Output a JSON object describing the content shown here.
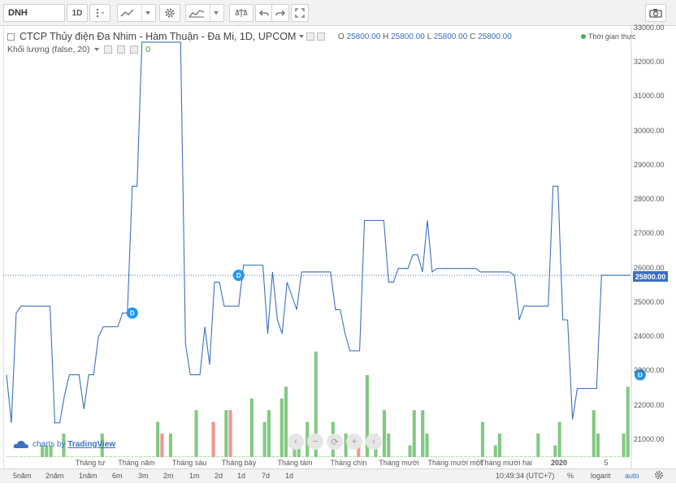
{
  "toolbar": {
    "symbol": "DNH",
    "interval": "1D",
    "camera_icon": "camera-icon"
  },
  "legend": {
    "title": "CTCP Thủy điện Đa Nhim - Hàm Thuận - Đa Mi, 1D, UPCOM",
    "o_label": "O",
    "o_value": "25800.00",
    "h_label": "H",
    "h_value": "25800.00",
    "l_label": "L",
    "l_value": "25800.00",
    "c_label": "C",
    "c_value": "25800.00",
    "volume_label": "Khối lượng (false, 20)",
    "volume_value": "0",
    "realtime": "Thời gian thực"
  },
  "branding": {
    "prefix": "charts by",
    "name": "TradingView"
  },
  "price_scale": {
    "labels": [
      "33000.00",
      "32000.00",
      "31000.00",
      "30000.00",
      "29000.00",
      "28000.00",
      "27000.00",
      "26000.00",
      "25000.00",
      "24000.00",
      "23000.00",
      "22000.00",
      "21000.00"
    ],
    "last_price": "25800.00"
  },
  "time_scale": {
    "labels": [
      "Tháng tư",
      "Tháng năm",
      "Tháng sáu",
      "Tháng bảy",
      "Tháng tám",
      "Tháng chín",
      "Tháng mười",
      "Tháng mười một",
      "Tháng mười hai",
      "2020",
      "5"
    ]
  },
  "bottom_bar": {
    "ranges": [
      "5năm",
      "2năm",
      "1năm",
      "6m",
      "3m",
      "2m",
      "1m",
      "2d",
      "1d",
      "7d",
      "1d"
    ],
    "time": "10:49:34",
    "timezone": "(UTC+7)",
    "percent": "%",
    "log": "logarit",
    "auto": "auto"
  },
  "colors": {
    "line": "#3b6fc4",
    "volume_up": "#6cc06c",
    "volume_down": "#f08080",
    "marker": "#2196f3"
  },
  "chart_data": {
    "type": "line",
    "symbol": "DNH",
    "series": [
      {
        "values": [
          22900,
          21500,
          24700,
          24900,
          24900,
          24900,
          24900,
          24900,
          24900,
          24900,
          21500,
          21500,
          22300,
          22900,
          22900,
          22900,
          21900,
          22900,
          22900,
          24000,
          24300,
          24300,
          24300,
          24300,
          24700,
          24700,
          28400,
          28400,
          32600,
          32600,
          32600,
          32600,
          32600,
          32600,
          32600,
          32600,
          32600,
          23800,
          22900,
          22900,
          22900,
          24300,
          23200,
          25600,
          25600,
          24900,
          24900,
          24900,
          24900,
          26100,
          26100,
          26100,
          26100,
          26100,
          24100,
          25900,
          24500,
          24100,
          25600,
          25200,
          24800,
          25900,
          25900,
          25900,
          25900,
          25900,
          25900,
          25900,
          24800,
          24800,
          24100,
          23600,
          23600,
          23600,
          27400,
          27400,
          27400,
          27400,
          27400,
          25600,
          25600,
          26000,
          26000,
          26000,
          26400,
          26400,
          25900,
          27400,
          25900,
          26000,
          26000,
          26000,
          26000,
          26000,
          26000,
          26000,
          26000,
          26000,
          25900,
          25900,
          25900,
          25900,
          25900,
          25900,
          25900,
          25800,
          24500,
          24900,
          24900,
          24900,
          24900,
          24900,
          24900,
          28400,
          28400,
          24500,
          24500,
          21600,
          22500,
          22500,
          22500,
          22500,
          22500,
          25800,
          25800,
          25800,
          25800,
          25800,
          25800,
          25800
        ],
        "ylim": [
          20500,
          33000
        ]
      }
    ],
    "volume": [
      0,
      0,
      0,
      0,
      0,
      0,
      0,
      0,
      1,
      1,
      1,
      0,
      0,
      2,
      0,
      0,
      0,
      0,
      0,
      0,
      0,
      0,
      2,
      0,
      0,
      0,
      0,
      0,
      0,
      0,
      0,
      0,
      0,
      0,
      0,
      3,
      2,
      0,
      2,
      0,
      0,
      0,
      0,
      0,
      4,
      0,
      0,
      0,
      3,
      0,
      0,
      4,
      4,
      0,
      0,
      0,
      0,
      5,
      0,
      0,
      3,
      4,
      0,
      0,
      5,
      6,
      0,
      1,
      1,
      0,
      3,
      0,
      9,
      0,
      0,
      0,
      3,
      0,
      0,
      2,
      0,
      0,
      1,
      0,
      7,
      0,
      2,
      0,
      4,
      2,
      0,
      0,
      0,
      0,
      1,
      4,
      0,
      4,
      2,
      0,
      0,
      0,
      0,
      0,
      0,
      0,
      0,
      0,
      0,
      0,
      0,
      3,
      0,
      0,
      1,
      2,
      0,
      0,
      0,
      0,
      0,
      0,
      0,
      0,
      2,
      0,
      0,
      0,
      1,
      3,
      0,
      0,
      0,
      0,
      0,
      0,
      0,
      4,
      2,
      0,
      0,
      0,
      0,
      0,
      2,
      6
    ],
    "volume_down_indices": [
      36,
      48,
      52,
      82,
      140
    ],
    "markers": [
      {
        "label": "D",
        "x_index": 26,
        "value": 24700
      },
      {
        "label": "D",
        "x_index": 48,
        "value": 25800
      },
      {
        "label": "D",
        "x_index": 131,
        "value": 22900
      }
    ],
    "dotted_line_value": 25800
  }
}
